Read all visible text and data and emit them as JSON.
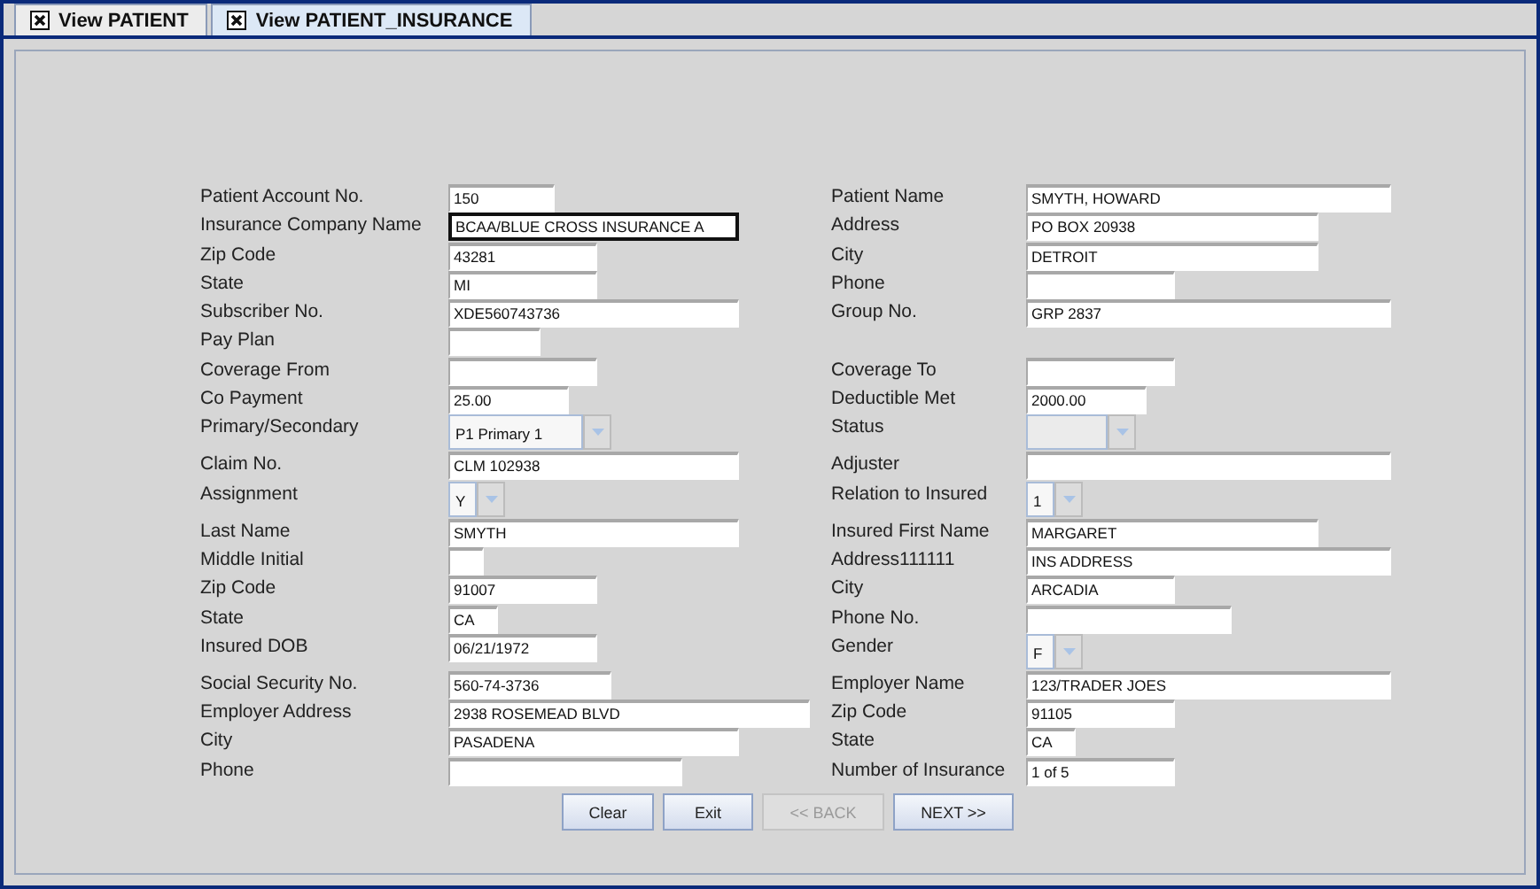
{
  "tabs": [
    {
      "label": "View PATIENT",
      "selected": false
    },
    {
      "label": "View PATIENT_INSURANCE",
      "selected": true
    }
  ],
  "rows": [
    {
      "left": {
        "label": "Patient Account No.",
        "kind": "text",
        "value": "150",
        "focused": false
      },
      "right": {
        "label": "Patient Name",
        "kind": "text",
        "value": "SMYTH, HOWARD",
        "focused": false
      }
    },
    {
      "left": {
        "label": "Insurance Company Name",
        "kind": "text",
        "value": "BCAA/BLUE CROSS INSURANCE A",
        "focused": true
      },
      "right": {
        "label": "Address",
        "kind": "text",
        "value": "PO BOX 20938",
        "focused": false
      }
    },
    {
      "left": {
        "label": "Zip Code",
        "kind": "text",
        "value": "43281",
        "focused": false
      },
      "right": {
        "label": "City",
        "kind": "text",
        "value": "DETROIT",
        "focused": false
      }
    },
    {
      "left": {
        "label": "State",
        "kind": "text",
        "value": "MI",
        "focused": false
      },
      "right": {
        "label": "Phone",
        "kind": "text",
        "focused": false
      }
    },
    {
      "left": {
        "label": "Subscriber No.",
        "kind": "text",
        "value": "XDE560743736",
        "focused": false
      },
      "right": {
        "label": "Group No.",
        "kind": "text",
        "value": "GRP 2837",
        "focused": false
      }
    },
    {
      "left": {
        "label": "Pay Plan",
        "kind": "text",
        "focused": false
      }
    },
    {
      "left": {
        "label": "Coverage From",
        "kind": "text",
        "focused": false
      },
      "right": {
        "label": "Coverage To",
        "kind": "text",
        "focused": false
      }
    },
    {
      "left": {
        "label": "Co Payment",
        "kind": "text",
        "value": "25.00",
        "focused": false
      },
      "right": {
        "label": "Deductible Met",
        "kind": "text",
        "value": "2000.00",
        "focused": false
      }
    },
    {
      "left": {
        "label": "Primary/Secondary",
        "kind": "combo",
        "value": "P1 Primary 1",
        "disabled": false
      },
      "right": {
        "label": "Status",
        "kind": "combo",
        "disabled": true
      }
    },
    {
      "left": {
        "label": "Claim No.",
        "kind": "text",
        "value": "CLM 102938",
        "focused": false
      },
      "right": {
        "label": "Adjuster",
        "kind": "text",
        "focused": false
      }
    },
    {
      "left": {
        "label": "Assignment",
        "kind": "combo",
        "value": "Y",
        "disabled": false
      },
      "right": {
        "label": "Relation to Insured",
        "kind": "combo",
        "value": "1",
        "disabled": false
      }
    },
    {
      "left": {
        "label": "Last Name",
        "kind": "text",
        "value": "SMYTH",
        "focused": false
      },
      "right": {
        "label": "Insured First Name",
        "kind": "text",
        "value": "MARGARET",
        "focused": false
      }
    },
    {
      "left": {
        "label": "Middle Initial",
        "kind": "text",
        "focused": false
      },
      "right": {
        "label": "Address111111",
        "kind": "text",
        "value": "INS ADDRESS",
        "focused": false
      }
    },
    {
      "left": {
        "label": "Zip Code",
        "kind": "text",
        "value": "91007",
        "focused": false
      },
      "right": {
        "label": "City",
        "kind": "text",
        "value": "ARCADIA",
        "focused": false
      }
    },
    {
      "left": {
        "label": "State",
        "kind": "text",
        "value": "CA",
        "focused": false
      },
      "right": {
        "label": "Phone No.",
        "kind": "text",
        "focused": false
      }
    },
    {
      "left": {
        "label": "Insured DOB",
        "kind": "text",
        "value": "06/21/1972",
        "focused": false
      },
      "right": {
        "label": "Gender",
        "kind": "combo",
        "value": "F",
        "disabled": false
      }
    },
    {
      "left": {
        "label": "Social Security No.",
        "kind": "text",
        "value": "560-74-3736",
        "focused": false
      },
      "right": {
        "label": "Employer Name",
        "kind": "text",
        "value": "123/TRADER JOES",
        "focused": false
      }
    },
    {
      "left": {
        "label": "Employer Address",
        "kind": "text",
        "value": "2938 ROSEMEAD BLVD",
        "focused": false
      },
      "right": {
        "label": "Zip Code",
        "kind": "text",
        "value": "91105",
        "focused": false
      }
    },
    {
      "left": {
        "label": "City",
        "kind": "text",
        "value": "PASADENA",
        "focused": false
      },
      "right": {
        "label": "State",
        "kind": "text",
        "value": "CA",
        "focused": false
      }
    },
    {
      "left": {
        "label": "Phone",
        "kind": "text",
        "focused": false
      },
      "right": {
        "label": "Number of Insurance",
        "kind": "text",
        "value": "1 of 5",
        "focused": false
      }
    }
  ],
  "buttons": [
    {
      "label": "Clear",
      "disabled": false
    },
    {
      "label": "Exit",
      "disabled": false
    },
    {
      "label": "<< BACK",
      "disabled": true
    },
    {
      "label": "NEXT >>",
      "disabled": false
    }
  ]
}
